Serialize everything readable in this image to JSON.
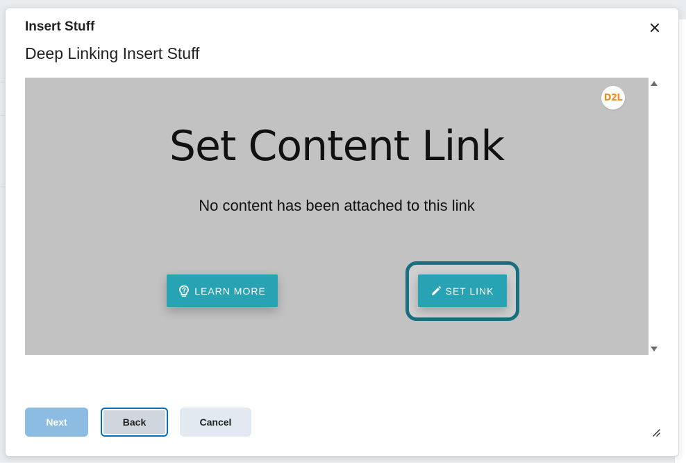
{
  "dialog": {
    "title": "Insert Stuff",
    "subtitle": "Deep Linking Insert Stuff",
    "close_icon": "close-icon"
  },
  "frame": {
    "logo_text": "D2L",
    "heading": "Set Content Link",
    "description": "No content has been attached to this link",
    "learn_more_label": "LEARN MORE",
    "learn_more_icon": "lightbulb-question-icon",
    "set_link_label": "SET LINK",
    "set_link_icon": "pencil-icon",
    "accent_color": "#27a3b3",
    "focus_ring_color": "#1a6f7f"
  },
  "footer": {
    "next_label": "Next",
    "back_label": "Back",
    "cancel_label": "Cancel"
  }
}
